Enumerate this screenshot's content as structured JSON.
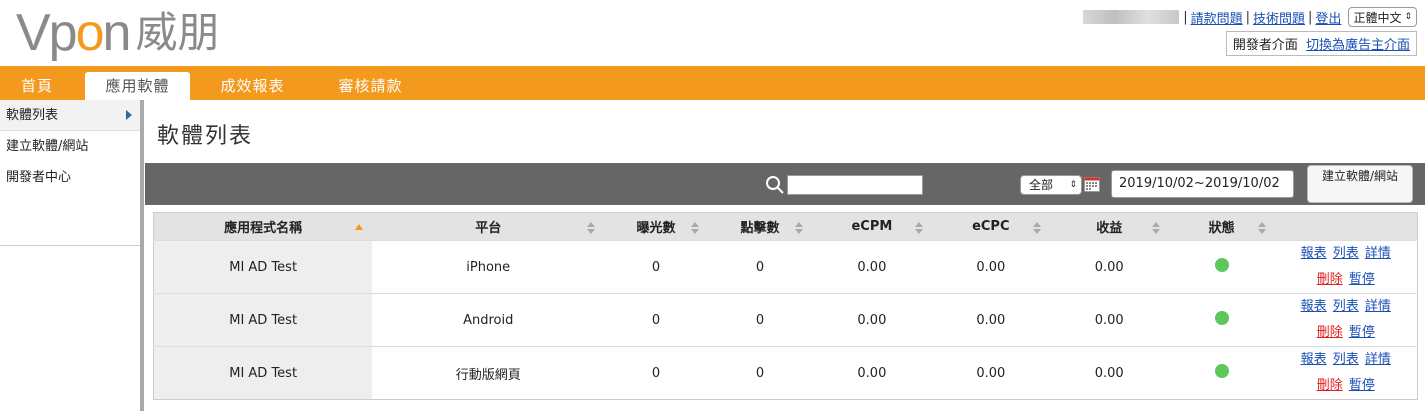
{
  "header": {
    "logo": {
      "brand_prefix": "Vp",
      "brand_o": "o",
      "brand_suffix": "n",
      "brand_cn": "威朋"
    },
    "links": {
      "billing": "請款問題",
      "tech": "技術問題",
      "logout": "登出"
    },
    "language": "正體中文",
    "dev_label": "開發者介面",
    "switch_link": "切換為廣告主介面"
  },
  "nav": {
    "tabs": [
      "首頁",
      "應用軟體",
      "成效報表",
      "審核請款"
    ],
    "active_index": 1
  },
  "sidebar": {
    "items": [
      {
        "label": "軟體列表",
        "active": true
      },
      {
        "label": "建立軟體/網站"
      },
      {
        "label": "開發者中心"
      }
    ]
  },
  "main": {
    "title": "軟體列表",
    "toolbar": {
      "search_value": "",
      "range_select": "全部",
      "date_range": "2019/10/02~2019/10/02",
      "create_button": "建立軟體/網站"
    },
    "table": {
      "columns": [
        "應用程式名稱",
        "平台",
        "曝光數",
        "點擊數",
        "eCPM",
        "eCPC",
        "收益",
        "狀態"
      ],
      "rows": [
        {
          "name": "MI AD Test",
          "platform": "iPhone",
          "impressions": "0",
          "clicks": "0",
          "ecpm": "0.00",
          "ecpc": "0.00",
          "revenue": "0.00",
          "status": "active"
        },
        {
          "name": "MI AD Test",
          "platform": "Android",
          "impressions": "0",
          "clicks": "0",
          "ecpm": "0.00",
          "ecpc": "0.00",
          "revenue": "0.00",
          "status": "active"
        },
        {
          "name": "MI AD Test",
          "platform": "行動版網頁",
          "impressions": "0",
          "clicks": "0",
          "ecpm": "0.00",
          "ecpc": "0.00",
          "revenue": "0.00",
          "status": "active"
        }
      ],
      "actions": {
        "report": "報表",
        "list": "列表",
        "details": "詳情",
        "delete": "刪除",
        "pause": "暫停"
      }
    }
  },
  "colors": {
    "brand_orange": "#f39a1e",
    "toolbar_gray": "#666666",
    "link_blue": "#1a4fb4",
    "delete_red": "#e02020",
    "status_green": "#5cc85c"
  }
}
